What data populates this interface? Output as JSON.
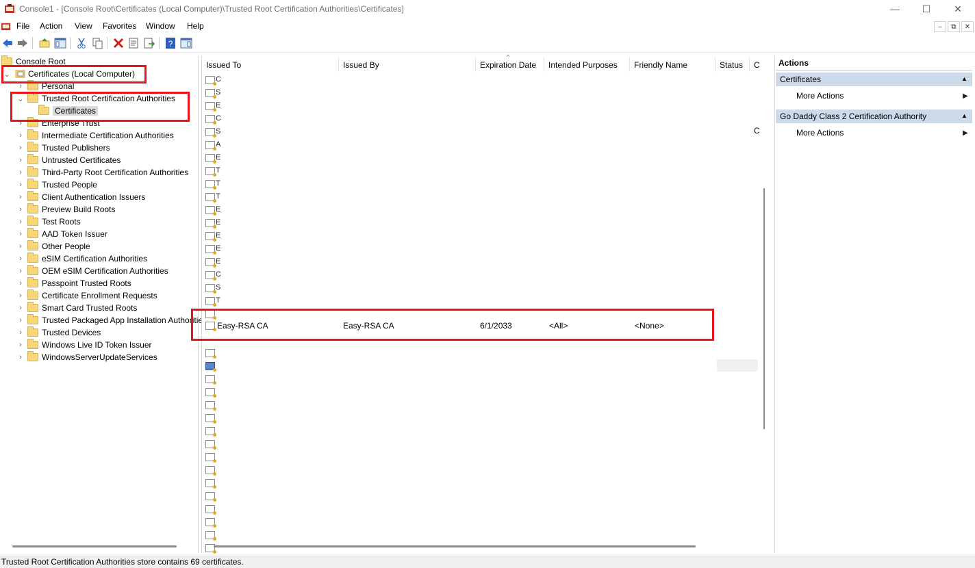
{
  "window": {
    "title": "Console1 - [Console Root\\Certificates (Local Computer)\\Trusted Root Certification Authorities\\Certificates]",
    "minimize": "—",
    "maximize": "☐",
    "close": "✕"
  },
  "menu": {
    "items": [
      "File",
      "Action",
      "View",
      "Favorites",
      "Window",
      "Help"
    ]
  },
  "toolbar": {
    "icons": [
      "back-icon",
      "forward-icon",
      "up-folder-icon",
      "show-hide-tree-icon",
      "cut-icon",
      "copy-icon",
      "delete-icon",
      "properties-icon",
      "export-icon",
      "help-icon",
      "show-hide-action-icon"
    ]
  },
  "tree": {
    "root": "Console Root",
    "certificates_node": "Certificates (Local Computer)",
    "items": [
      "Personal",
      "Trusted Root Certification Authorities",
      "Certificates",
      "Enterprise Trust",
      "Intermediate Certification Authorities",
      "Trusted Publishers",
      "Untrusted Certificates",
      "Third-Party Root Certification Authorities",
      "Trusted People",
      "Client Authentication Issuers",
      "Preview Build Roots",
      "Test Roots",
      "AAD Token Issuer",
      "Other People",
      "eSIM Certification Authorities",
      "OEM eSIM Certification Authorities",
      "Passpoint Trusted Roots",
      "Certificate Enrollment Requests",
      "Smart Card Trusted Roots",
      "Trusted Packaged App Installation Authorities",
      "Trusted Devices",
      "Windows Live ID Token Issuer",
      "WindowsServerUpdateServices"
    ]
  },
  "list": {
    "columns": [
      "Issued To",
      "Issued By",
      "Expiration Date",
      "Intended Purposes",
      "Friendly Name",
      "Status",
      "C"
    ],
    "row_letters": [
      "C",
      "S",
      "E",
      "C",
      "S",
      "A",
      "E",
      "T",
      "T",
      "T",
      "E",
      "E",
      "E",
      "E",
      "E",
      "C",
      "S",
      "T"
    ],
    "extra_letter": "C",
    "highlighted_row": {
      "issued_to": "Easy-RSA CA",
      "issued_by": "Easy-RSA CA",
      "expiration": "6/1/2033",
      "purposes": "<All>",
      "friendly_name": "<None>"
    }
  },
  "actions": {
    "title": "Actions",
    "sections": [
      {
        "header": "Certificates",
        "item": "More Actions"
      },
      {
        "header": "Go Daddy Class 2 Certification Authority",
        "item": "More Actions"
      }
    ]
  },
  "status": {
    "text": "Trusted Root Certification Authorities store contains 69 certificates."
  },
  "colors": {
    "highlight_box": "#e8141b",
    "actions_header": "#ccd9e8",
    "folder": "#f6d77a"
  }
}
